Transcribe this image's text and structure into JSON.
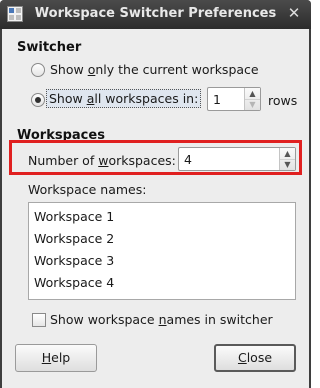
{
  "window": {
    "title": "Workspace Switcher Preferences",
    "close_glyph": "✕"
  },
  "switcher": {
    "heading": "Switcher",
    "option_current": {
      "pre": "Show ",
      "ul": "o",
      "post": "nly the current workspace",
      "selected": false
    },
    "option_all": {
      "pre": "Show ",
      "ul": "a",
      "post": "ll workspaces in:",
      "selected": true
    },
    "rows_value": "1",
    "rows_label": "rows"
  },
  "workspaces": {
    "heading": "Workspaces",
    "number_label": {
      "pre": "Number of ",
      "ul": "w",
      "post": "orkspaces:"
    },
    "number_value": "4",
    "names_label": "Workspace names:",
    "names": [
      "Workspace 1",
      "Workspace 2",
      "Workspace 3",
      "Workspace 4"
    ],
    "show_names": {
      "pre": "Show workspace ",
      "ul": "n",
      "post": "ames in switcher",
      "checked": false
    }
  },
  "buttons": {
    "help": {
      "ul": "H",
      "post": "elp"
    },
    "close": {
      "ul": "C",
      "post": "lose"
    }
  },
  "colors": {
    "highlight": "#e02020",
    "titlebar": "#3a3a3a"
  }
}
